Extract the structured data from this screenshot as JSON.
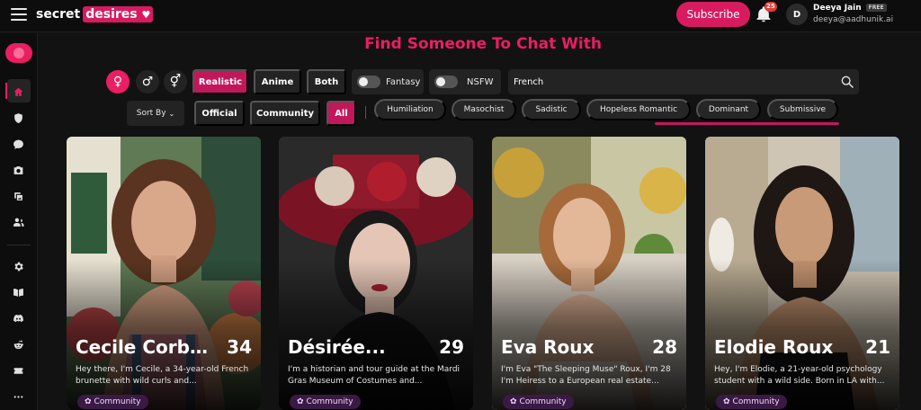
{
  "header": {
    "logo_word1": "secret",
    "logo_word2": "desires",
    "subscribe_label": "Subscribe",
    "notification_count": "25",
    "avatar_initial": "D",
    "user_name": "Deeya Jain",
    "plan_badge": "FREE",
    "user_email": "deeya@aadhunik.ai"
  },
  "sidebar": {
    "icons": [
      "home-icon",
      "shield-icon",
      "chat-icon",
      "camera-icon",
      "gallery-icon",
      "users-icon",
      "gear-icon",
      "book-icon",
      "discord-icon",
      "reddit-icon",
      "ticket-icon",
      "more-icon"
    ]
  },
  "page": {
    "heading": "Find Someone To Chat With"
  },
  "filters": {
    "gender": [
      "female-icon",
      "male-icon",
      "trans-icon"
    ],
    "style_options": [
      "Realistic",
      "Anime",
      "Both"
    ],
    "style_selected": "Realistic",
    "fantasy_label": "Fantasy",
    "nsfw_label": "NSFW",
    "search_value": "French",
    "sort_label": "Sort By",
    "source_options": [
      "Official",
      "Community",
      "All"
    ],
    "source_selected": "All",
    "tags": [
      "Humiliation",
      "Masochist",
      "Sadistic",
      "Hopeless Romantic",
      "Dominant",
      "Submissive"
    ]
  },
  "characters": [
    {
      "name": "Cecile Corbet",
      "age": "34",
      "desc": "Hey there, I'm Cecile, a 34-year-old French brunette with wild curls and...",
      "badge": "Community"
    },
    {
      "name": "Désirée...",
      "age": "29",
      "desc": "I'm a historian and tour guide at the Mardi Gras Museum of Costumes and...",
      "badge": "Community"
    },
    {
      "name": "Eva Roux",
      "age": "28",
      "desc": "I'm Eva \"The Sleeping Muse\" Roux, I'm 28 I'm Heiress to a European real estate...",
      "badge": "Community"
    },
    {
      "name": "Elodie Roux",
      "age": "21",
      "desc": "Hey, I'm Elodie, a 21-year-old psychology student with a wild side. Born in LA with...",
      "badge": "Community"
    }
  ],
  "colors": {
    "accent": "#e91e63",
    "accent_dark": "#c2185b",
    "background": "#121212"
  }
}
